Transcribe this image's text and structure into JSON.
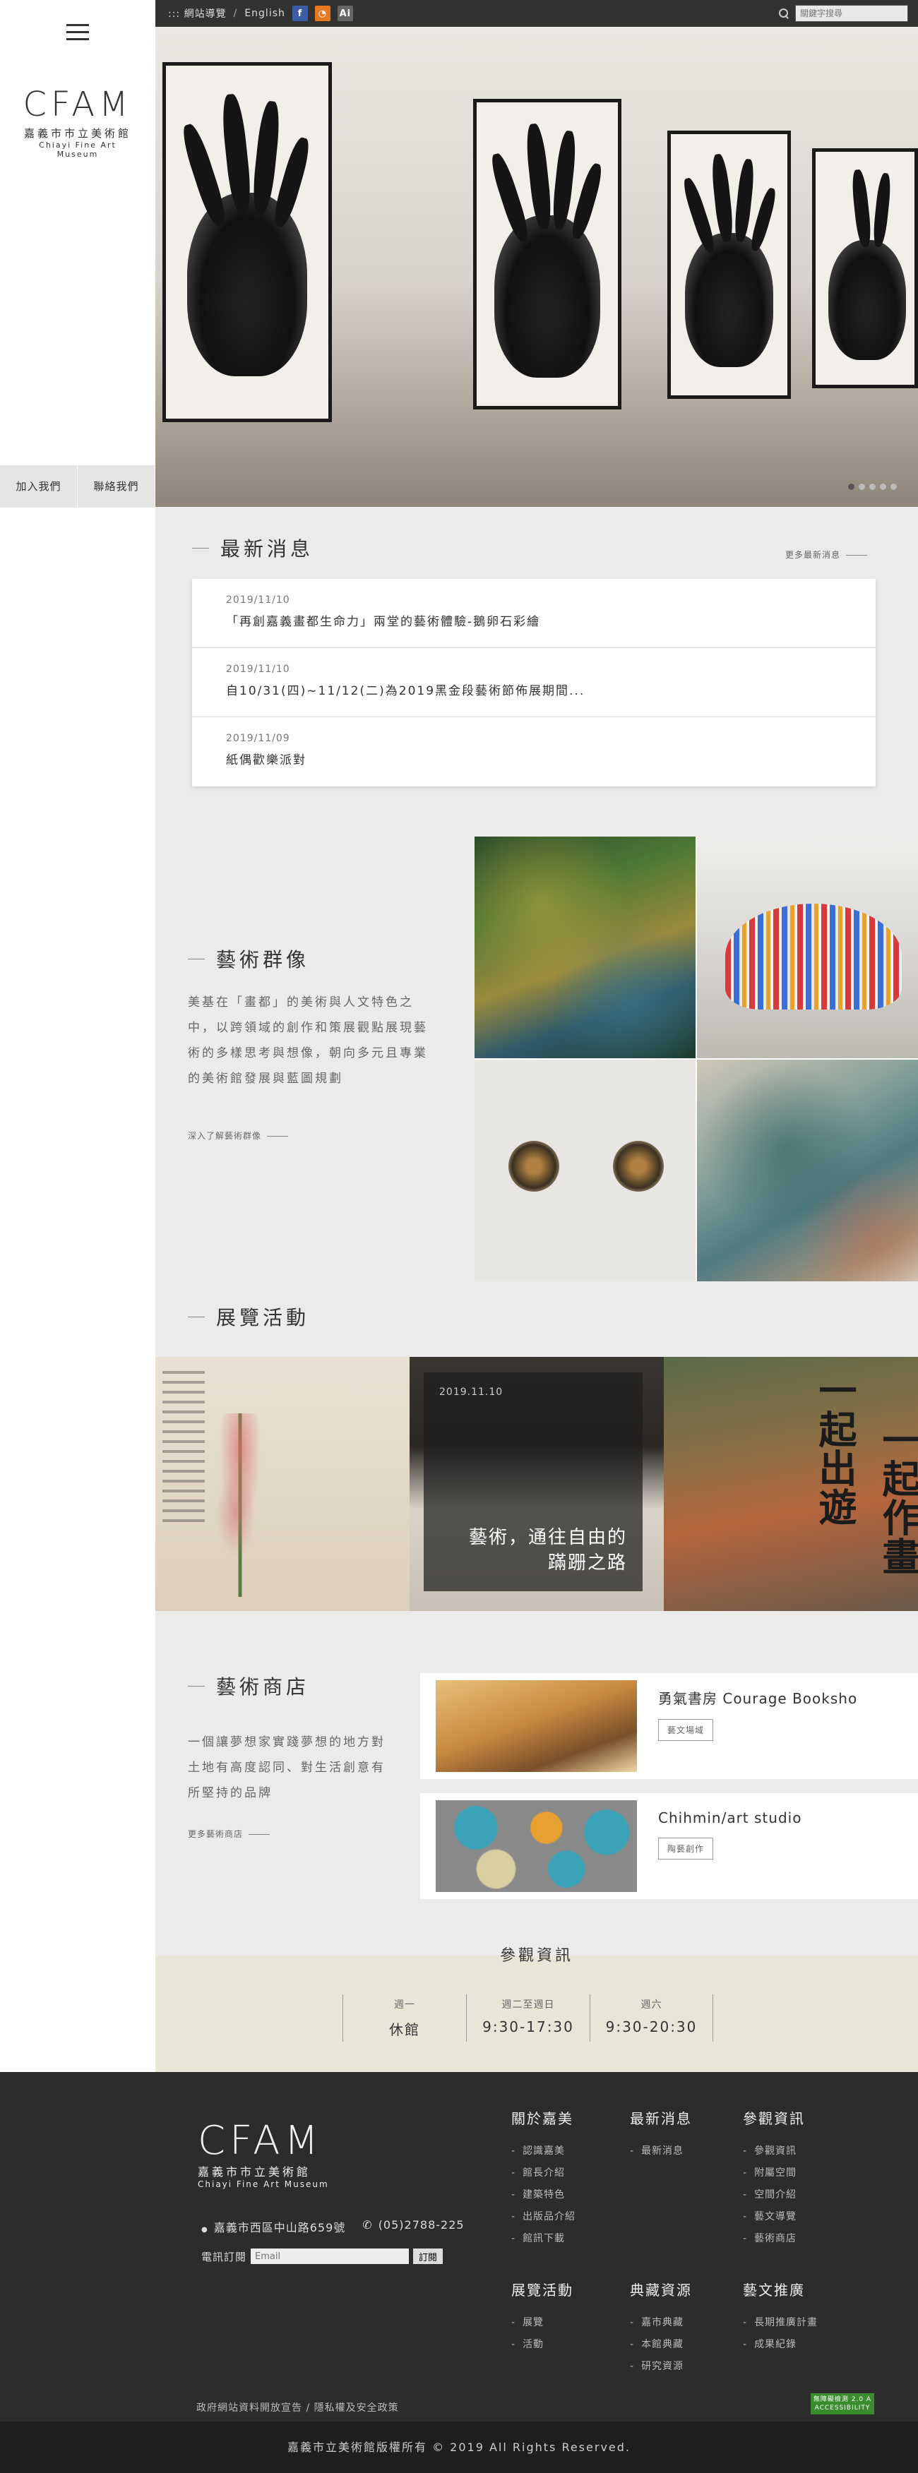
{
  "brand": {
    "logo_mark": "CFAM",
    "name_zh": "嘉義市市立美術館",
    "name_en": "Chiayi Fine Art Museum"
  },
  "topbar": {
    "sitemap": "::: 網站導覽",
    "sep": "/",
    "english": "English",
    "fb": "f",
    "rss": "◔",
    "ai": "Ai",
    "search_placeholder": "關鍵字搜尋"
  },
  "sidebar": {
    "join": "加入我們",
    "contact": "聯絡我們"
  },
  "news": {
    "title": "最新消息",
    "more": "更多最新消息",
    "items": [
      {
        "date": "2019/11/10",
        "title": "「再創嘉義畫都生命力」兩堂的藝術體驗-鵝卵石彩繪"
      },
      {
        "date": "2019/11/10",
        "title": "自10/31(四)~11/12(二)為2019黑金段藝術節佈展期間..."
      },
      {
        "date": "2019/11/09",
        "title": "紙偶歡樂派對"
      }
    ]
  },
  "artists": {
    "title": "藝術群像",
    "desc": "美基在「畫都」的美術與人文特色之中，以跨領域的創作和策展觀點展現藝術的多樣思考與想像，朝向多元且專業的美術館發展與藍圖規劃",
    "more": "深入了解藝術群像"
  },
  "exhibitions": {
    "title": "展覽活動",
    "feature_date": "2019.11.10",
    "feature_title_1": "藝術，通往自由的",
    "feature_title_2": "蹣跚之路",
    "calligraphy_1": "一起出遊",
    "calligraphy_2": "一起作畫"
  },
  "shop": {
    "title": "藝術商店",
    "desc": "一個讓夢想家實踐夢想的地方對土地有高度認同、對生活創意有所堅持的品牌",
    "more": "更多藝術商店",
    "items": [
      {
        "name": "勇氣書房 Courage Booksho",
        "tag": "藝文場域"
      },
      {
        "name": "Chihmin/art studio",
        "tag": "陶藝創作"
      }
    ]
  },
  "visit": {
    "title": "參觀資訊",
    "cols": [
      {
        "label": "週一",
        "value": "休館"
      },
      {
        "label": "週二至週日",
        "value": "9:30-17:30"
      },
      {
        "label": "週六",
        "value": "9:30-20:30"
      }
    ]
  },
  "footer": {
    "address": "嘉義市西區中山路659號",
    "phone": "(05)2788-225",
    "subscribe_label": "電訊訂閱",
    "email_placeholder": "Email",
    "subscribe_btn": "訂閱",
    "cols": [
      {
        "title": "關於嘉美",
        "links": [
          "認識嘉美",
          "館長介紹",
          "建築特色",
          "出版品介紹",
          "館訊下載"
        ]
      },
      {
        "title": "最新消息",
        "links": [
          "最新消息"
        ]
      },
      {
        "title": "參觀資訊",
        "links": [
          "參觀資訊",
          "附屬空間",
          "空間介紹",
          "藝文導覽",
          "藝術商店"
        ]
      },
      {
        "title": "展覽活動",
        "links": [
          "展覽",
          "活動"
        ]
      },
      {
        "title": "典藏資源",
        "links": [
          "嘉市典藏",
          "本館典藏",
          "研究資源"
        ]
      },
      {
        "title": "藝文推廣",
        "links": [
          "長期推廣計畫",
          "成果紀錄"
        ]
      }
    ],
    "policy": "政府網站資料開放宣告 / 隱私權及安全政策",
    "badge": "無障礙檢測 2.0 A ACCESSIBILITY",
    "copyright": "嘉義市立美術館版權所有 © 2019 All Rights Reserved."
  },
  "colors": {
    "accent": "#3b5ca8",
    "footer_bg": "#2c2c2c",
    "visit_bg": "#e9e6d8"
  }
}
